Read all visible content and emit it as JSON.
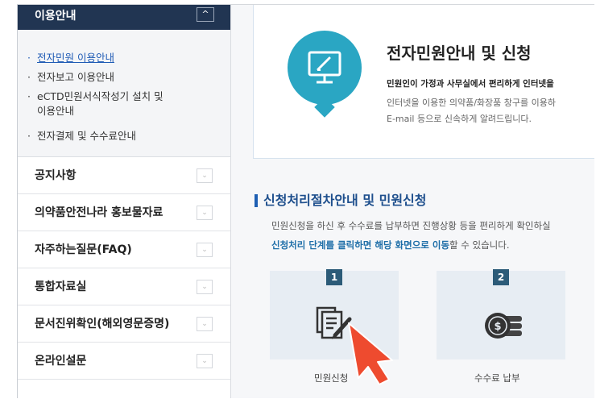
{
  "sidebar": {
    "section_title": "이용안내",
    "collapse_symbol": "^",
    "sub_items": [
      {
        "label": "전자민원 이용안내",
        "active": true
      },
      {
        "label": "전자보고 이용안내",
        "active": false
      },
      {
        "label": "eCTD민원서식작성기 설치 및",
        "line2": "이용안내",
        "active": false
      },
      {
        "label": "전자결제 및 수수료안내",
        "active": false
      }
    ],
    "menu": [
      {
        "label": "공지사항"
      },
      {
        "label": "의약품안전나라 홍보물자료"
      },
      {
        "label": "자주하는질문(FAQ)"
      },
      {
        "label": "통합자료실"
      },
      {
        "label": "문서진위확인(해외영문증명)"
      },
      {
        "label": "온라인설문"
      }
    ],
    "bullet": "·",
    "chevron": "⌄"
  },
  "intro": {
    "title": "전자민원안내 및 신청",
    "bold_line": "민원인이 가정과 사무실에서 편리하게 인터넷을",
    "line1": "인터넷을 이용한 의약품/화장품 창구를 이용하",
    "line2": "E-mail 등으로 신속하게 알려드립니다.",
    "icon": "monitor-pen-icon",
    "accent_color": "#2aa6c3"
  },
  "procedure": {
    "title": "신청처리절차안내 및 민원신청",
    "desc1": "민원신청을 하신 후 수수료를 납부하면 진행상황 등을 편리하게 확인하실",
    "desc2_highlight": "신청처리 단계를 클릭하면 해당 화면으로 이동",
    "desc2_rest": "할 수 있습니다.",
    "steps": [
      {
        "num": "1",
        "label": "민원신청",
        "icon": "document-pen-icon"
      },
      {
        "num": "2",
        "label": "수수료 납부",
        "icon": "coins-icon"
      }
    ]
  },
  "cursor_icon": "hand-pointer-arrow-icon"
}
